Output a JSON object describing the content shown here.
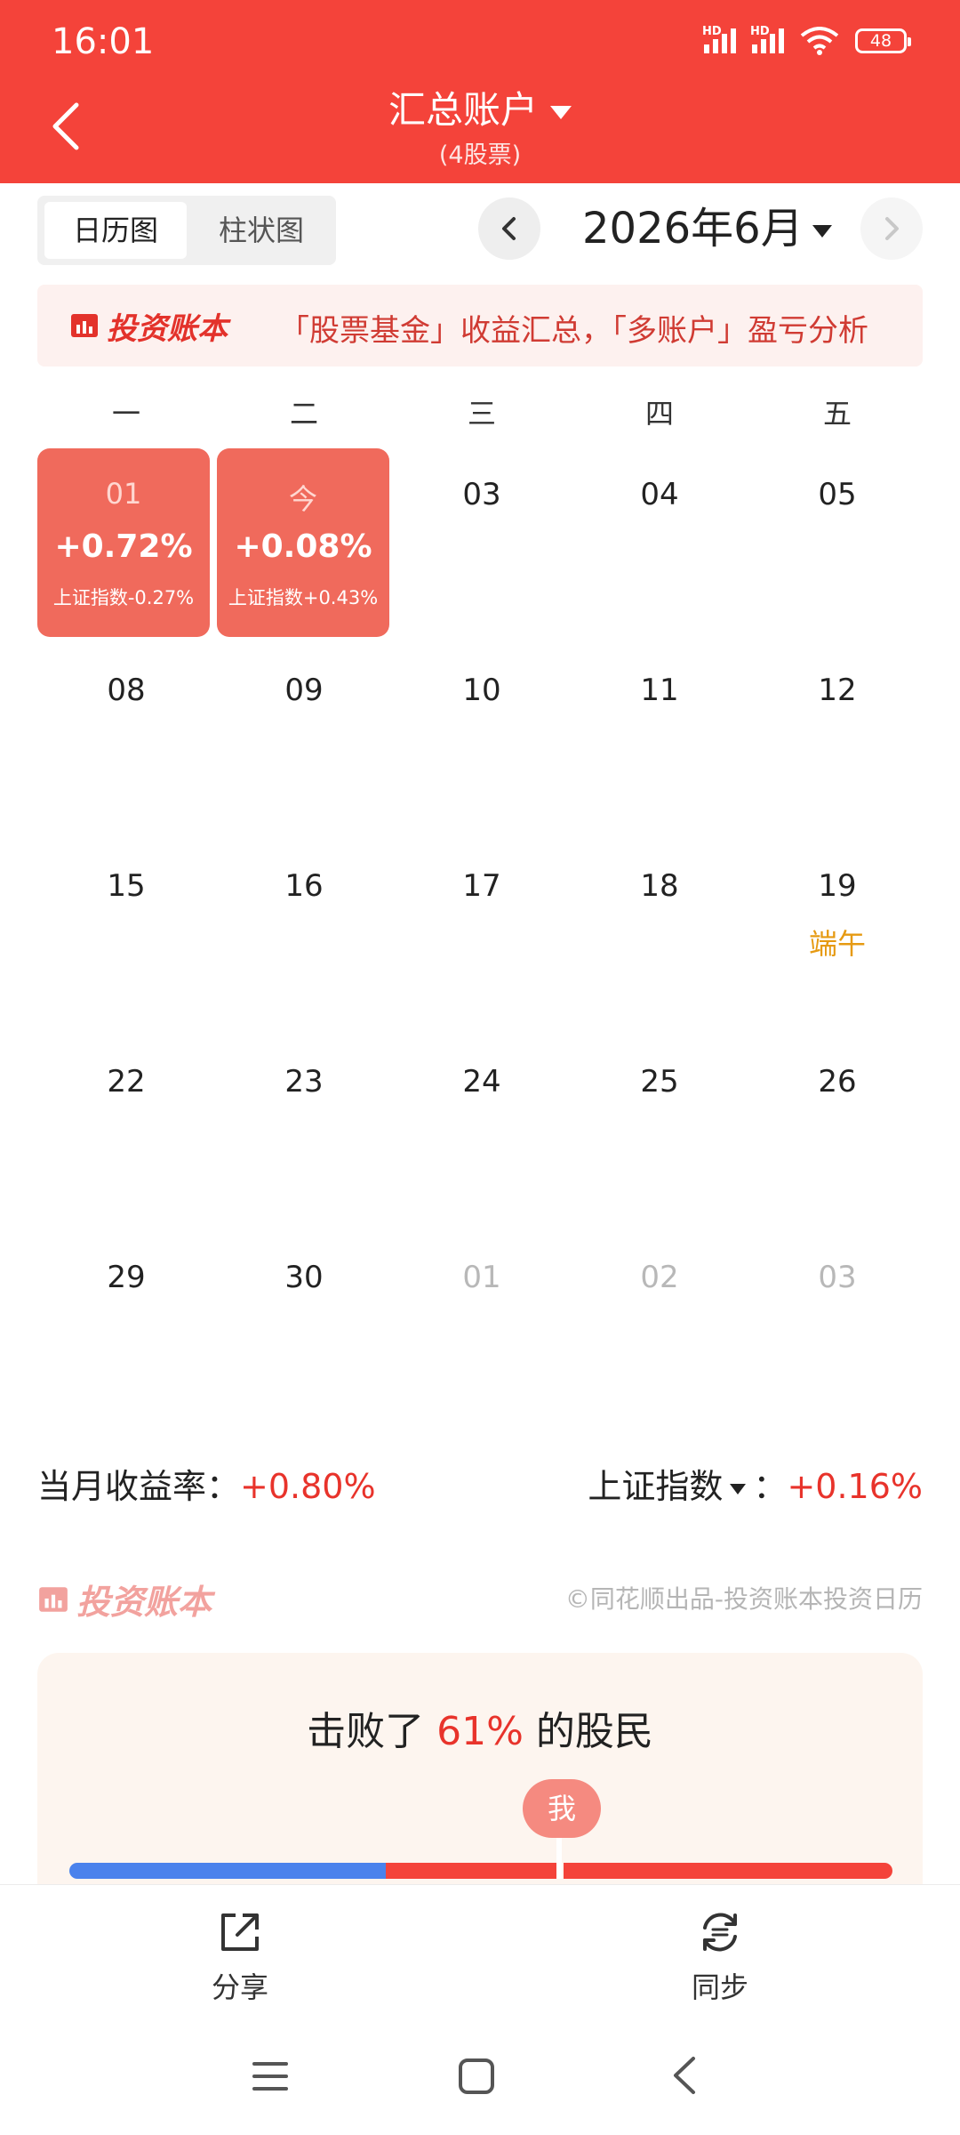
{
  "status_bar": {
    "time": "16:01",
    "signal_label": "HD",
    "battery": "48"
  },
  "header": {
    "title": "汇总账户",
    "subtitle": "(4股票)"
  },
  "view_toggle": {
    "calendar": "日历图",
    "bar": "柱状图"
  },
  "month_nav": {
    "label": "2026年6月"
  },
  "promo": {
    "logo": "投资账本",
    "text": "「股票基金」收益汇总，「多账户」盈亏分析"
  },
  "weekdays": [
    "一",
    "二",
    "三",
    "四",
    "五"
  ],
  "calendar": {
    "cells": [
      {
        "day": "01",
        "profit": "+0.72%",
        "index": "上证指数-0.27%"
      },
      {
        "day": "今",
        "profit": "+0.08%",
        "index": "上证指数+0.43%"
      }
    ],
    "days": {
      "r1": [
        "03",
        "04",
        "05"
      ],
      "r2": [
        "08",
        "09",
        "10",
        "11",
        "12"
      ],
      "r3": [
        "15",
        "16",
        "17",
        "18",
        "19"
      ],
      "r4": [
        "22",
        "23",
        "24",
        "25",
        "26"
      ],
      "r5": [
        "29",
        "30"
      ],
      "next": [
        "01",
        "02",
        "03"
      ]
    },
    "holiday": "端午"
  },
  "summary": {
    "month_label": "当月收益率：",
    "month_value": "+0.80%",
    "index_label": "上证指数",
    "index_sep": "：",
    "index_value": "+0.16%"
  },
  "footer_brand": {
    "logo": "投资账本",
    "copyright": "©同花顺出品-投资账本投资日历"
  },
  "beat": {
    "prefix": "击败了",
    "percent": "61%",
    "suffix": "的股民",
    "me": "我"
  },
  "bottom_bar": {
    "share": "分享",
    "sync": "同步"
  },
  "colors": {
    "brand_red": "#f4433a",
    "profit_cell": "#f06a5c",
    "holiday": "#e69a12",
    "blue": "#4a82ec"
  }
}
